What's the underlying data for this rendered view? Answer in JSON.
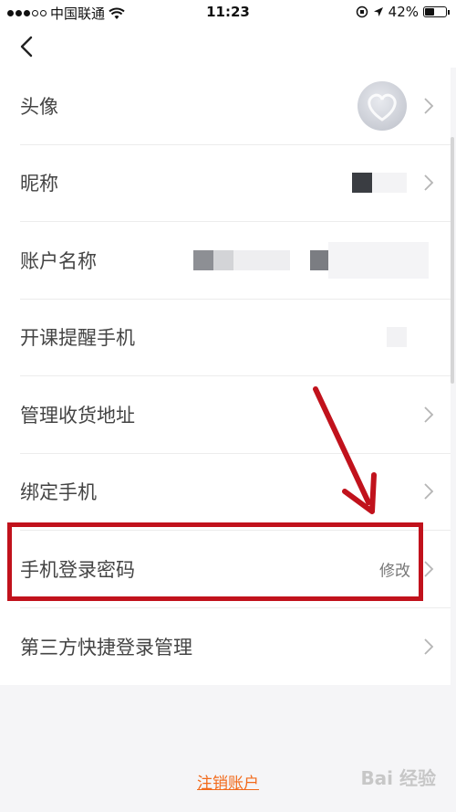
{
  "status_bar": {
    "carrier": "中国联通",
    "time": "11:23",
    "battery": "42%"
  },
  "nav": {
    "back_icon": "chevron-left-icon"
  },
  "rows": [
    {
      "label": "头像"
    },
    {
      "label": "昵称"
    },
    {
      "label": "账户名称"
    },
    {
      "label": "开课提醒手机"
    },
    {
      "label": "管理收货地址"
    },
    {
      "label": "绑定手机"
    },
    {
      "label": "手机登录密码",
      "value": "修改"
    },
    {
      "label": "第三方快捷登录管理"
    }
  ],
  "footer": {
    "deactivate_link": "注销账户"
  },
  "watermark": "Bai 经验",
  "colors": {
    "accent": "#f26a1b",
    "highlight_box": "#c1121c"
  }
}
